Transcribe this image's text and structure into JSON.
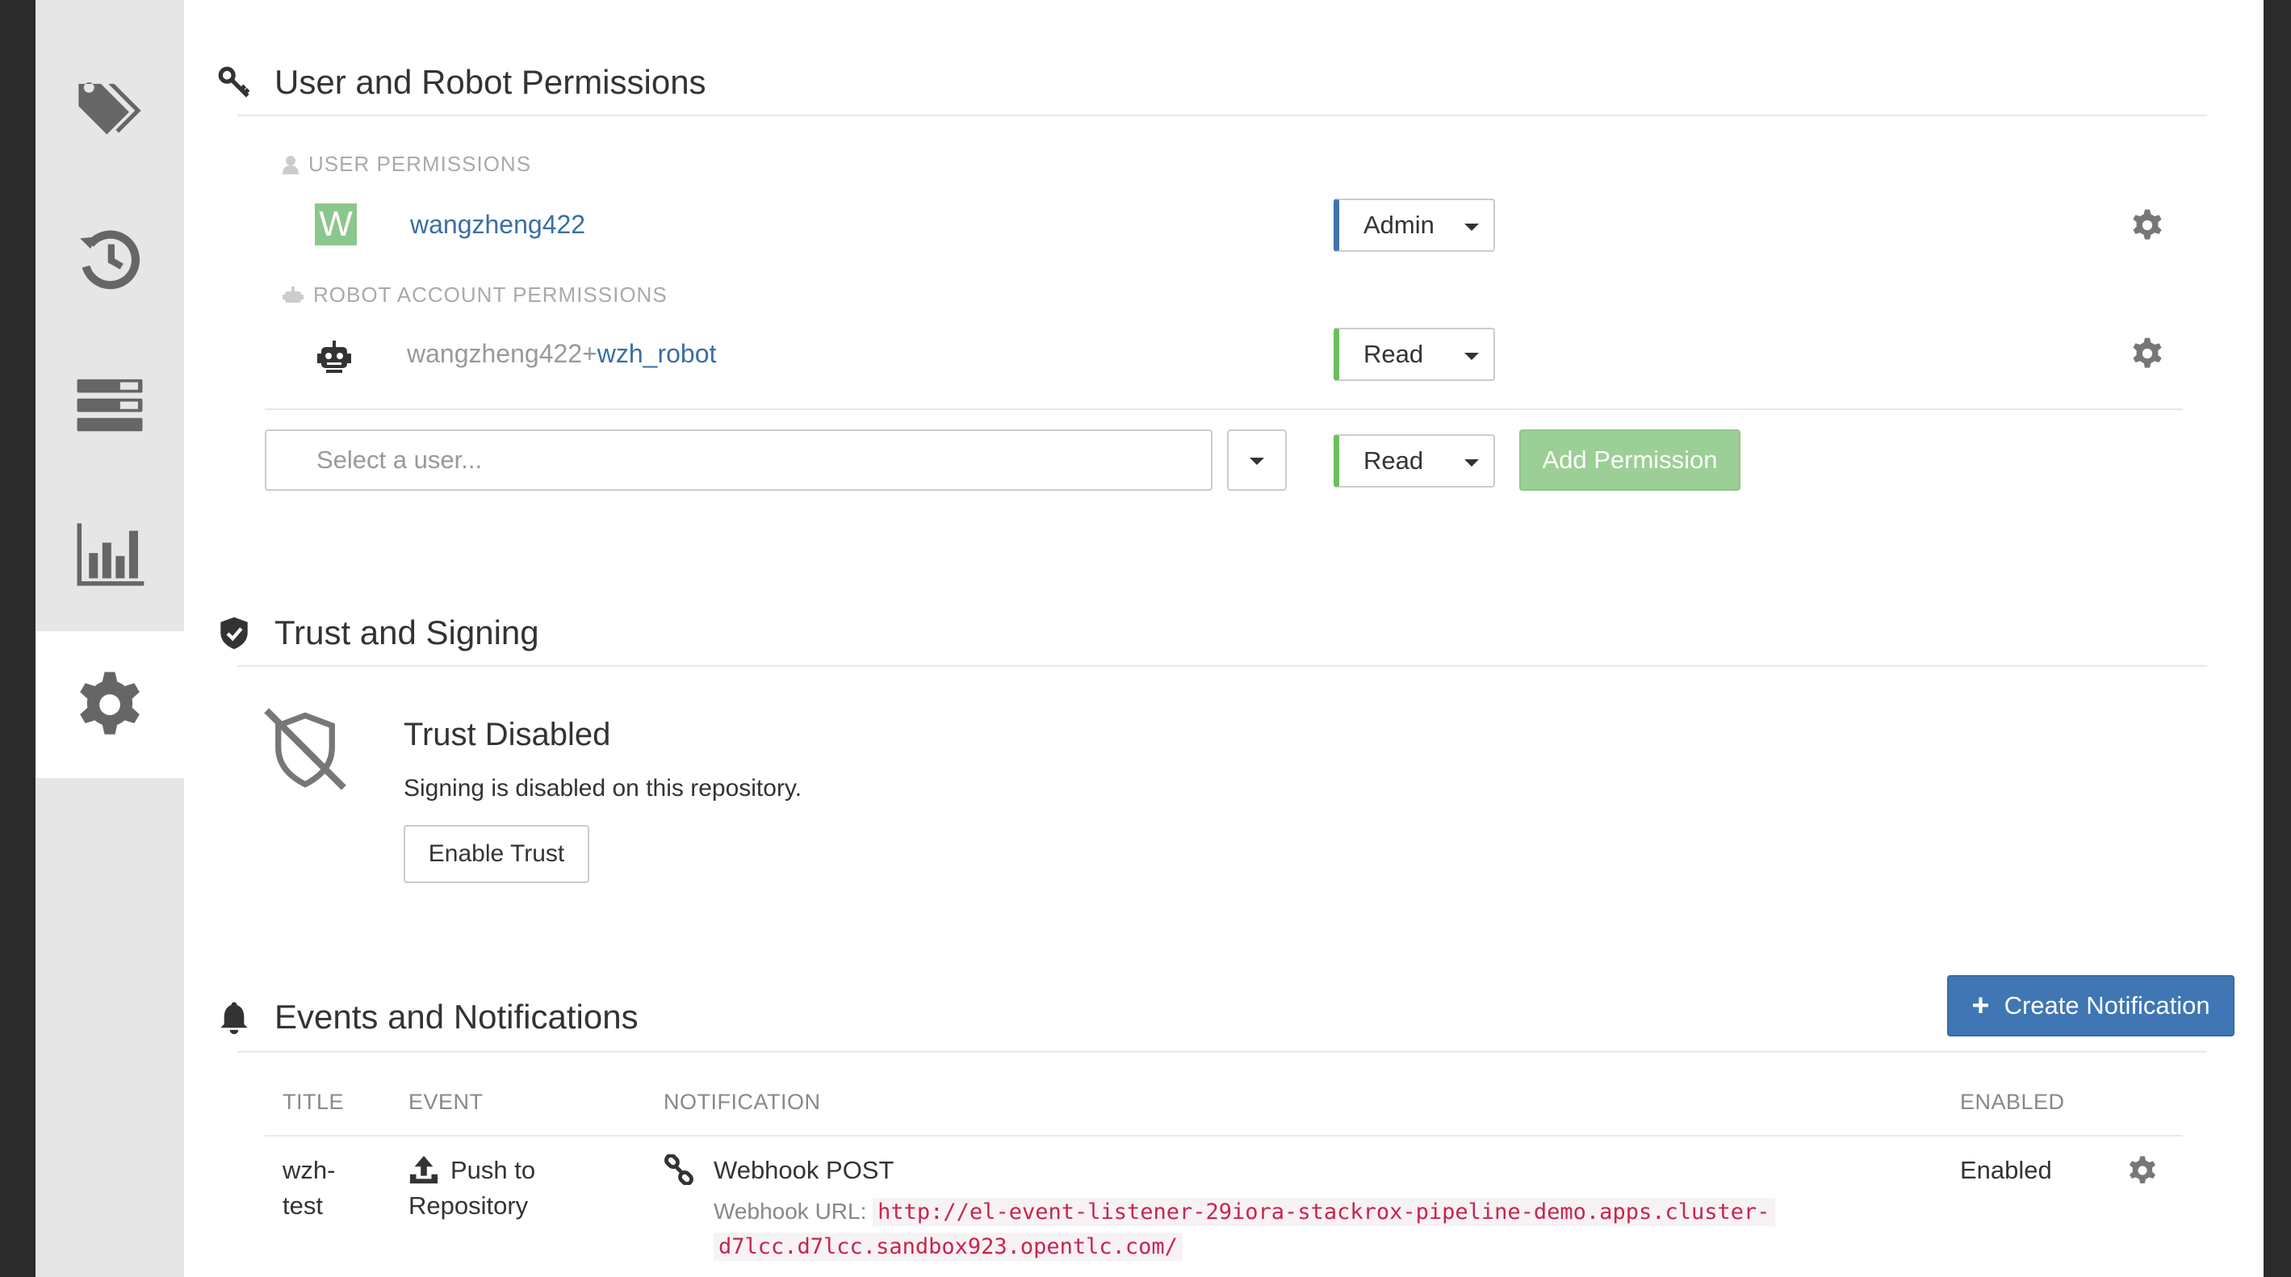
{
  "sidebar": {
    "items": [
      {
        "name": "tags-icon"
      },
      {
        "name": "history-icon"
      },
      {
        "name": "builds-icon"
      },
      {
        "name": "usage-logs-icon"
      },
      {
        "name": "settings-icon",
        "active": true
      }
    ]
  },
  "permissions": {
    "title": "User and Robot Permissions",
    "user_header": "USER PERMISSIONS",
    "robot_header": "ROBOT ACCOUNT PERMISSIONS",
    "user": {
      "avatar_letter": "W",
      "name": "wangzheng422",
      "role": "Admin"
    },
    "robot": {
      "prefix": "wangzheng422+",
      "name": "wzh_robot",
      "role": "Read"
    },
    "add": {
      "placeholder": "Select a user...",
      "role": "Read",
      "button": "Add Permission"
    }
  },
  "trust": {
    "title": "Trust and Signing",
    "status_title": "Trust Disabled",
    "status_text": "Signing is disabled on this repository.",
    "button": "Enable Trust"
  },
  "events": {
    "title": "Events and Notifications",
    "create_button": "Create Notification",
    "columns": {
      "title": "TITLE",
      "event": "EVENT",
      "notification": "NOTIFICATION",
      "enabled": "ENABLED"
    },
    "rows": [
      {
        "title_line1": "wzh-",
        "title_line2": "test",
        "event_line1": "Push to",
        "event_line2": "Repository",
        "notification": "Webhook POST",
        "url_label": "Webhook URL:",
        "url_line1": "http://el-event-listener-29iora-stackrox-pipeline-demo.apps.cluster-",
        "url_line2": "d7lcc.d7lcc.sandbox923.opentlc.com/",
        "enabled": "Enabled"
      }
    ]
  },
  "colors": {
    "admin_accent": "#3f74ad",
    "read_accent": "#6abf5b",
    "add_button": "#9ccf96",
    "primary_button": "#3f76b3",
    "link": "#3a6ea5",
    "code_text": "#c7254e"
  }
}
